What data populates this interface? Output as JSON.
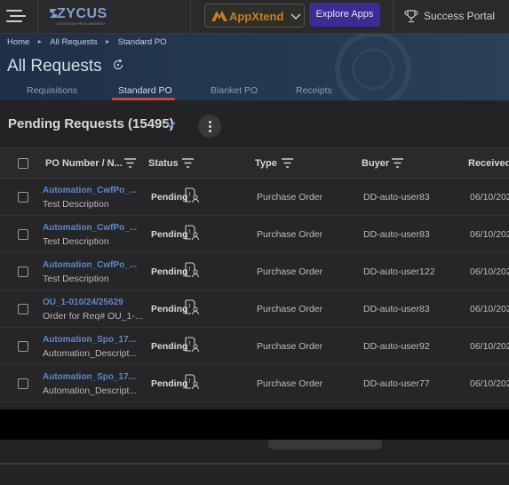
{
  "topbar": {
    "logo": {
      "name": "ZYCUS",
      "tagline": "COGNITIVE PROCUREMENT"
    },
    "appxtend_label": "AppXtend",
    "explore_label": "Explore Apps",
    "success_portal_label": "Success Portal",
    "icons": {
      "menu": "hamburger-icon",
      "dropdown": "chevron-down-icon",
      "trophy": "trophy-icon"
    }
  },
  "breadcrumb": [
    "Home",
    "All Requests",
    "Standard PO"
  ],
  "page_title": "All Requests",
  "tabs": [
    {
      "label": "Requisitions",
      "active": false
    },
    {
      "label": "Standard PO",
      "active": true
    },
    {
      "label": "Blanket PO",
      "active": false
    },
    {
      "label": "Receipts",
      "active": false
    }
  ],
  "pending": {
    "title": "Pending Requests (15495)"
  },
  "table": {
    "columns": [
      "PO Number / N...",
      "Status",
      "Type",
      "Buyer",
      "Received"
    ],
    "rows": [
      {
        "po": "Automation_CwfPo_...",
        "desc": "Test Description",
        "status": "Pending",
        "type": "Purchase Order",
        "buyer": "DD-auto-user83",
        "received": "06/10/202"
      },
      {
        "po": "Automation_CwfPo_...",
        "desc": "Test Description",
        "status": "Pending",
        "type": "Purchase Order",
        "buyer": "DD-auto-user83",
        "received": "06/10/202"
      },
      {
        "po": "Automation_CwfPo_...",
        "desc": "Test Description",
        "status": "Pending",
        "type": "Purchase Order",
        "buyer": "DD-auto-user122",
        "received": "06/10/202"
      },
      {
        "po": "OU_1-010/24/25629",
        "desc": "Order for Req# OU_1-...",
        "status": "Pending",
        "type": "Purchase Order",
        "buyer": "DD-auto-user83",
        "received": "06/10/202"
      },
      {
        "po": "Automation_Spo_17...",
        "desc": "Automation_Descript...",
        "status": "Pending",
        "type": "Purchase Order",
        "buyer": "DD-auto-user92",
        "received": "06/10/202"
      },
      {
        "po": "Automation_Spo_17...",
        "desc": "Automation_Descript...",
        "status": "Pending",
        "type": "Purchase Order",
        "buyer": "DD-auto-user77",
        "received": "06/10/202"
      }
    ]
  },
  "colors": {
    "accent": "#3d2a93",
    "link": "#5f86c7",
    "tab_underline": "#c04a44",
    "appxtend": "#c47f2e"
  }
}
